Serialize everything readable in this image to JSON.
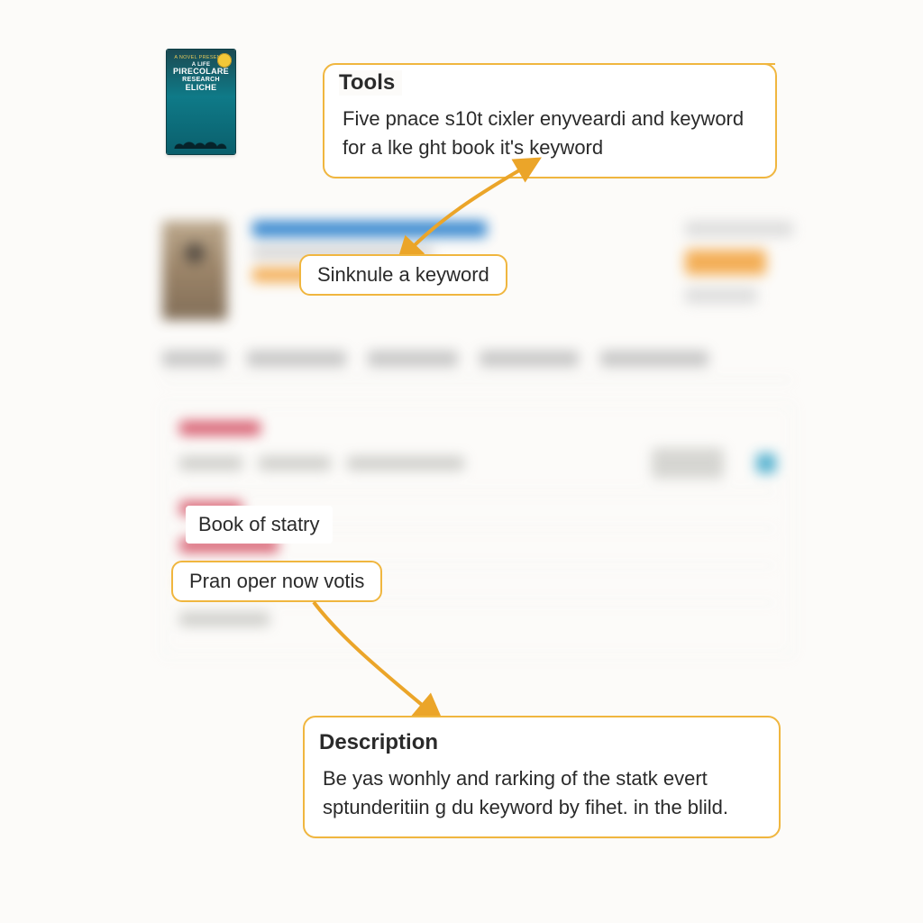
{
  "cover": {
    "tagline": "A NOVEL PRESENTS",
    "line1": "A LIFE",
    "line2": "PIRECOLARE",
    "line3": "RESEARCH",
    "line4": "ELICHE"
  },
  "callouts": {
    "tools": {
      "heading": "Tools",
      "body": "Five pnace s10t cixler enyveardi and keyword for a lke ght book it's keyword"
    },
    "description": {
      "heading": "Description",
      "body": "Be yas wonhly and rarking of the statk evert sptunderitiin g du keyword by fihet. in the blild."
    }
  },
  "highlights": {
    "keyword": "Sinknule a keyword",
    "book": "Book of statry",
    "pran": "Pran oper now votis"
  }
}
